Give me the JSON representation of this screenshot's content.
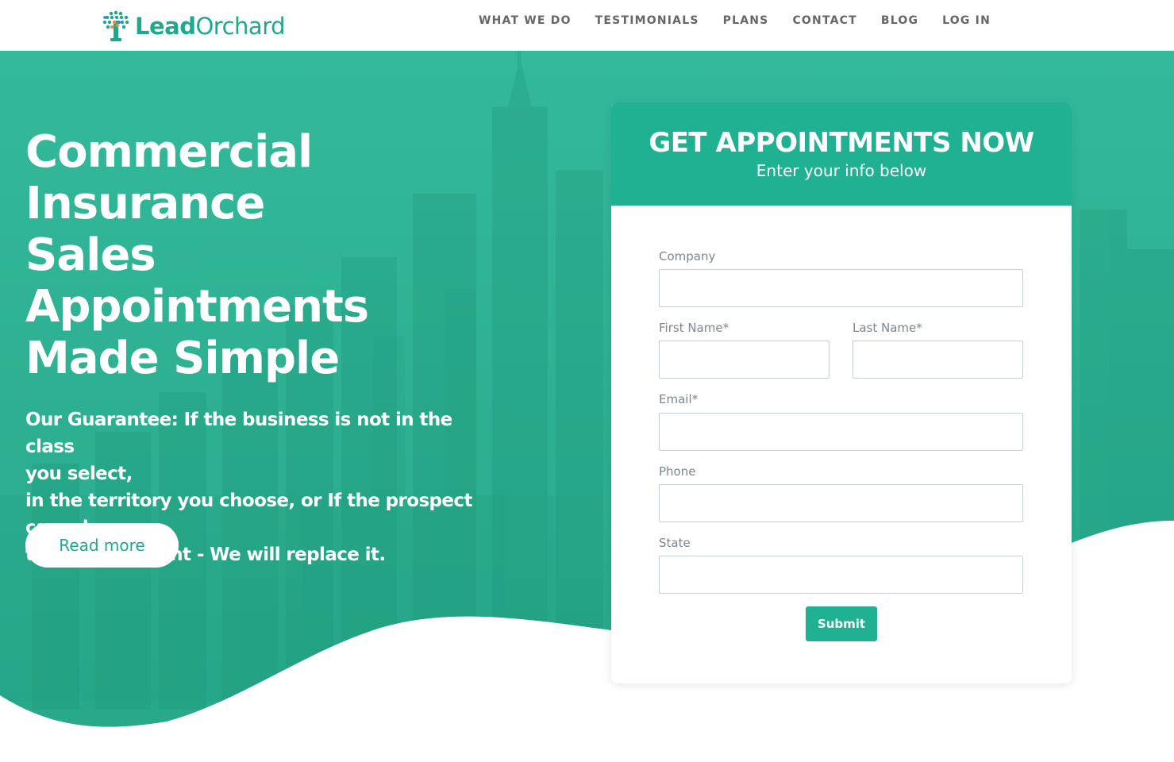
{
  "header": {
    "logo": {
      "text_bold": "Lead",
      "text_light": "Orchard",
      "icon": "tree-icon"
    },
    "nav": [
      "WHAT WE DO",
      "TESTIMONIALS",
      "PLANS",
      "CONTACT",
      "BLOG",
      "LOG IN"
    ]
  },
  "hero": {
    "title_lines": [
      "Commercial",
      "Insurance",
      "Sales Appointments",
      "Made Simple"
    ],
    "guarantee_lines": [
      "Our Guarantee: If the business is not in the class",
      "you select,",
      "in the territory you choose, or If the prospect",
      "cancels",
      "the appointment - We will replace it."
    ],
    "read_more_label": "Read more"
  },
  "form": {
    "title": "GET APPOINTMENTS NOW",
    "subtitle": "Enter your info below",
    "fields": {
      "company": {
        "label": "Company",
        "value": ""
      },
      "first_name": {
        "label": "First Name*",
        "value": ""
      },
      "last_name": {
        "label": "Last Name*",
        "value": ""
      },
      "email": {
        "label": "Email*",
        "value": ""
      },
      "phone": {
        "label": "Phone",
        "value": ""
      },
      "state": {
        "label": "State",
        "value": ""
      }
    },
    "submit_label": "Submit"
  },
  "colors": {
    "brand_green": "#1fb192",
    "hero_overlay": "#2fb596",
    "nav_text": "#666666",
    "label_text": "#7a8791"
  }
}
